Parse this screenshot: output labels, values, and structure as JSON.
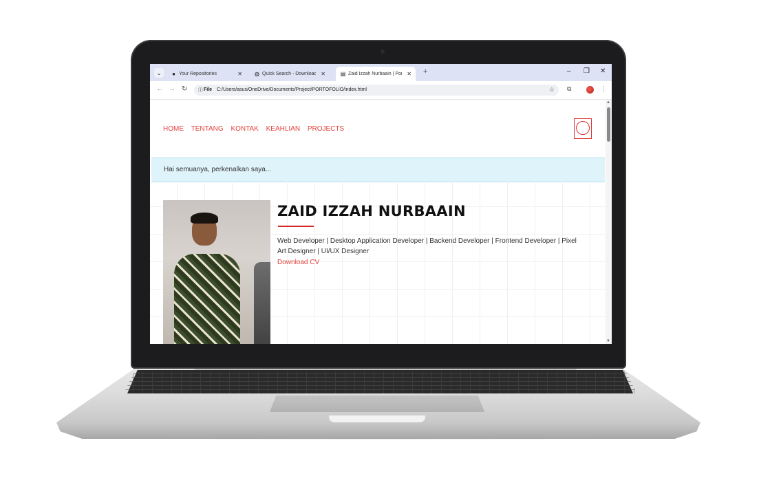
{
  "browser": {
    "tabs": [
      {
        "title": "Your Repositories",
        "favicon": "github-icon",
        "active": false
      },
      {
        "title": "Quick Search - Download Server",
        "favicon": "globe-icon",
        "active": false
      },
      {
        "title": "Zaid Izzah Nurbaain | Portofolio",
        "favicon": "page-icon",
        "active": true
      }
    ],
    "address": {
      "scheme": "File",
      "url": "C:/Users/asus/OneDrive/Documents/Project/PORTOFOLIO/index.html"
    }
  },
  "nav": {
    "items": [
      "HOME",
      "TENTANG",
      "KONTAK",
      "KEAHLIAN",
      "PROJECTS"
    ]
  },
  "greeting": "Hai semuanya, perkenalkan saya...",
  "profile": {
    "name": "ZAID IZZAH NURBAAIN",
    "roles": "Web Developer | Desktop Application Developer | Backend Developer | Frontend Developer | Pixel Art Designer | UI/UX Designer",
    "cv_label": "Download CV"
  },
  "colors": {
    "accent": "#e2433c",
    "banner": "#dff3fb",
    "bezel": "#1c1c1e"
  }
}
